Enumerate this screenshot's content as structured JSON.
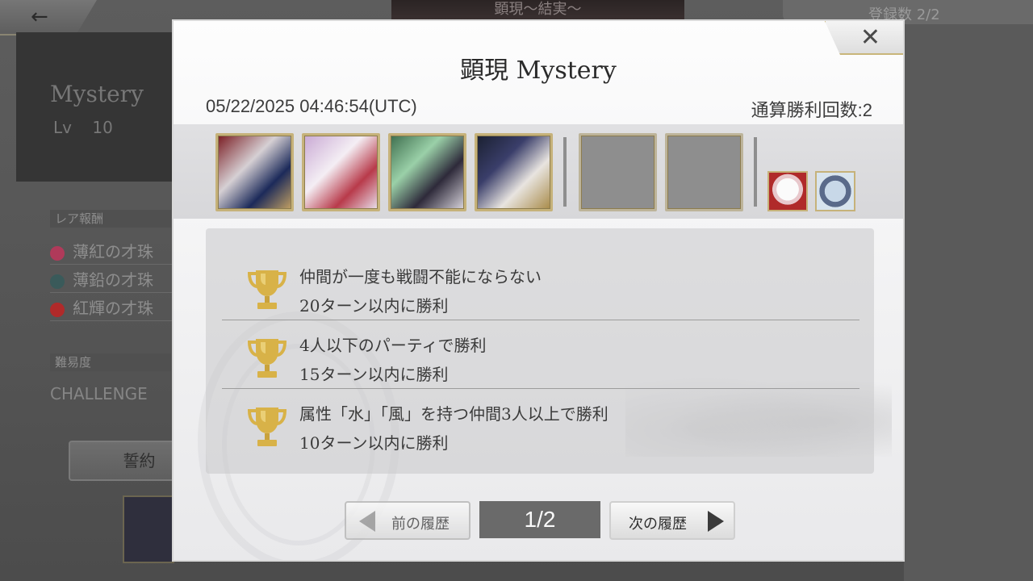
{
  "background": {
    "back_icon": "arrow-left-icon",
    "header_title": "顕現〜結実〜",
    "register_count": "登録数 2/2",
    "character_name": "Mystery",
    "level_label": "Lv",
    "level_value": "10",
    "rare_reward_label": "レア報酬",
    "rewards": [
      {
        "name": "薄紅の才珠",
        "color": "#b03a5a"
      },
      {
        "name": "薄鉛の才珠",
        "color": "#3a5a5a"
      },
      {
        "name": "紅輝の才珠",
        "color": "#b02a2a"
      }
    ],
    "difficulty_label": "難易度",
    "difficulty_value": "CHALLENGE",
    "vow_label": "誓約"
  },
  "modal": {
    "title": "顕現 Mystery",
    "datetime": "05/22/2025 04:46:54(UTC)",
    "total_wins": "通算勝利回数:2",
    "close_icon": "close-icon",
    "party": {
      "members": [
        "character-portrait",
        "character-portrait",
        "character-portrait",
        "character-portrait"
      ],
      "empty_slots": 2,
      "pets": [
        "pet-icon",
        "pet-icon"
      ]
    },
    "achievements": [
      {
        "line1": "仲間が一度も戦闘不能にならない",
        "line2": "20ターン以内に勝利",
        "icon": "trophy-icon"
      },
      {
        "line1": "4人以下のパーティで勝利",
        "line2": "15ターン以内に勝利",
        "icon": "trophy-icon"
      },
      {
        "line1": "属性「水」「風」を持つ仲間3人以上で勝利",
        "line2": "10ターン以内に勝利",
        "icon": "trophy-icon"
      }
    ],
    "nav": {
      "prev_label": "前の履歴",
      "next_label": "次の履歴",
      "page_indicator": "1/2"
    }
  },
  "colors": {
    "trophy_gold": "#d8b248",
    "frame_gold": "#c6b27a",
    "page_indicator_bg": "#6a6a6a"
  }
}
